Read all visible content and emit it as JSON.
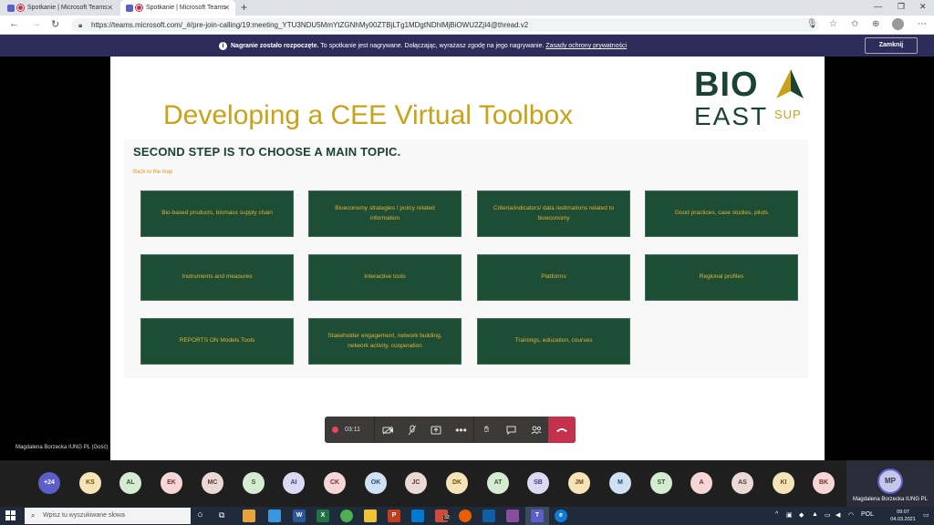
{
  "browser": {
    "tabs": [
      {
        "label": "Spotkanie | Microsoft Teams",
        "active": false
      },
      {
        "label": "Spotkanie | Microsoft Teams",
        "active": true
      }
    ],
    "new_tab_icon": "+",
    "url": "https://teams.microsoft.com/_#/pre-join-calling/19:meeting_YTU3NDU5MmYtZGNhMy00ZTBjLTg1MDgtNDhlMjBiOWU2ZjI4@thread.v2"
  },
  "banner": {
    "bold_text": "Nagranie zostało rozpoczęte.",
    "text": "To spotkanie jest nagrywane. Dołączając, wyrażasz zgodę na jego nagrywanie.",
    "link": "Zasady ochrony prywatności",
    "close_label": "Zamknij"
  },
  "slide": {
    "title": "Developing a CEE Virtual Toolbox",
    "logo": {
      "line1": "BIO",
      "line2": "EAST",
      "line3": "SUP"
    },
    "heading": "SECOND STEP IS TO CHOOSE A MAIN TOPIC.",
    "back_link": "Back to the map",
    "topics": [
      "Bio-based products, biomass supply chain",
      "Bioeconomy strategies / policy related information",
      "Criteria/indicators/ data /estimations related to bioeconomy",
      "Good practices, case studies, pilots",
      "Instruments and measures",
      "Interactive tools",
      "Platforms",
      "Regional profiles",
      "REPORTS ON Models Tools",
      "Stakeholder engagement, network building, network activity, cooperation",
      "Trainings, education, courses"
    ]
  },
  "call": {
    "timer": "03:11",
    "presenter": "Magdalena Borzecka IUNG PL (Gość)"
  },
  "participants": [
    {
      "initials": "+24",
      "bg": "#5b5fc7",
      "fg": "#ffffff"
    },
    {
      "initials": "KS",
      "bg": "#f7e3b8",
      "fg": "#6b4e12"
    },
    {
      "initials": "AL",
      "bg": "#d6ecd2",
      "fg": "#2f5b29"
    },
    {
      "initials": "EK",
      "bg": "#f6d6d6",
      "fg": "#7a2f2f"
    },
    {
      "initials": "MC",
      "bg": "#ead9d5",
      "fg": "#5a3a32"
    },
    {
      "initials": "S",
      "bg": "#d6ecd2",
      "fg": "#2f5b29"
    },
    {
      "initials": "AI",
      "bg": "#dcd9f2",
      "fg": "#3f3a8a"
    },
    {
      "initials": "CK",
      "bg": "#f6d6d6",
      "fg": "#7a2f2f"
    },
    {
      "initials": "OK",
      "bg": "#d0e1f3",
      "fg": "#234e7a"
    },
    {
      "initials": "JC",
      "bg": "#ead9d5",
      "fg": "#5a3a32"
    },
    {
      "initials": "DK",
      "bg": "#f7e3b8",
      "fg": "#6b4e12"
    },
    {
      "initials": "AT",
      "bg": "#d6ecd2",
      "fg": "#2f5b29"
    },
    {
      "initials": "SB",
      "bg": "#dcd9f2",
      "fg": "#3f3a8a"
    },
    {
      "initials": "JM",
      "bg": "#f7e3b8",
      "fg": "#6b4e12"
    },
    {
      "initials": "M",
      "bg": "#d0e1f3",
      "fg": "#234e7a"
    },
    {
      "initials": "ST",
      "bg": "#d6ecd2",
      "fg": "#2f5b29"
    },
    {
      "initials": "A",
      "bg": "#f6d6d6",
      "fg": "#7a2f2f"
    },
    {
      "initials": "AS",
      "bg": "#ead9d5",
      "fg": "#5a3a32"
    },
    {
      "initials": "KI",
      "bg": "#f7e3b8",
      "fg": "#6b4e12"
    },
    {
      "initials": "BK",
      "bg": "#f6d6d6",
      "fg": "#7a2f2f"
    }
  ],
  "self": {
    "initials": "MP",
    "name": "Magdalena Borzecka IUNG PL"
  },
  "taskbar": {
    "search_placeholder": "Wpisz tu wyszukiwane słowa",
    "badge": "32",
    "language": "POL",
    "time": "09:07",
    "date": "04.03.2021"
  },
  "colors": {
    "teams_purple": "#5b5fc7",
    "tile_green": "#1d4d34",
    "title_gold": "#c9a217",
    "banner_bg": "#2d2c5a",
    "hangup_red": "#c4314b"
  }
}
